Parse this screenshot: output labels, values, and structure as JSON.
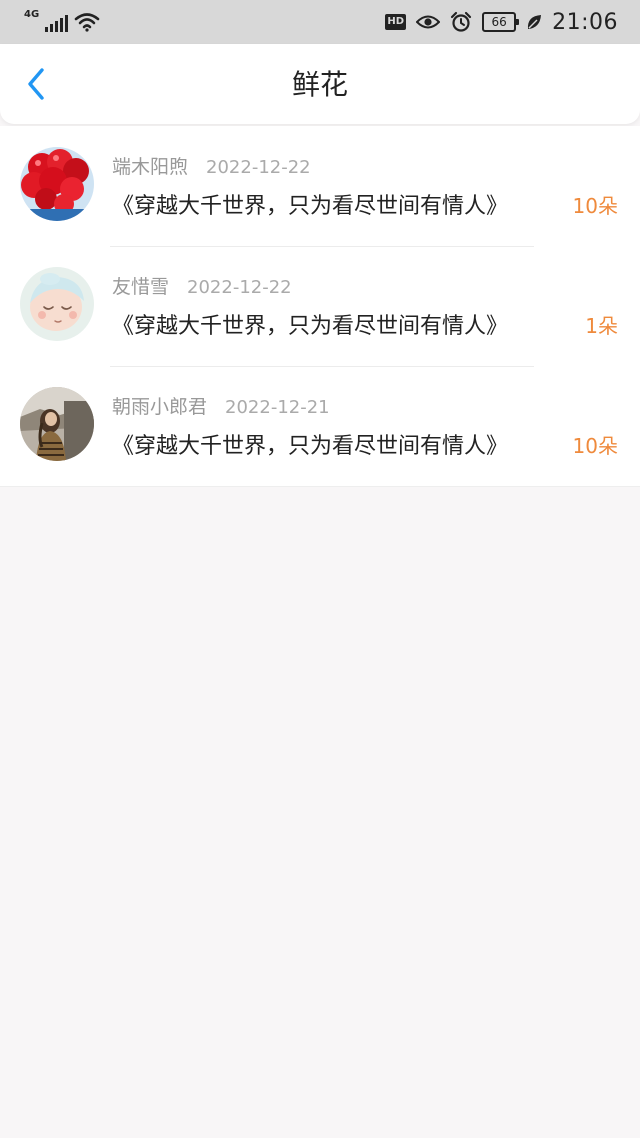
{
  "status_bar": {
    "network": "4G",
    "battery": "66",
    "time": "21:06",
    "icons": [
      "signal-icon",
      "wifi-icon",
      "hd-icon",
      "eye-icon",
      "alarm-icon",
      "battery-icon",
      "leaf-icon"
    ]
  },
  "header": {
    "title": "鲜花",
    "back_icon": "chevron-left-icon",
    "accent_color": "#2196f3"
  },
  "gifts": [
    {
      "name": "端木阳煦",
      "date": "2022-12-22",
      "message": "《穿越大千世界，只为看尽世间有情人》",
      "count": "10朵",
      "avatar": "red-balloons"
    },
    {
      "name": "友惜雪",
      "date": "2022-12-22",
      "message": "《穿越大千世界，只为看尽世间有情人》",
      "count": "1朵",
      "avatar": "sleeping-baby"
    },
    {
      "name": "朝雨小郎君",
      "date": "2022-12-21",
      "message": "《穿越大千世界，只为看尽世间有情人》",
      "count": "10朵",
      "avatar": "girl-photo"
    }
  ],
  "colors": {
    "count": "#ef8a3c",
    "meta": "#999999",
    "background": "#f8f6f7"
  }
}
